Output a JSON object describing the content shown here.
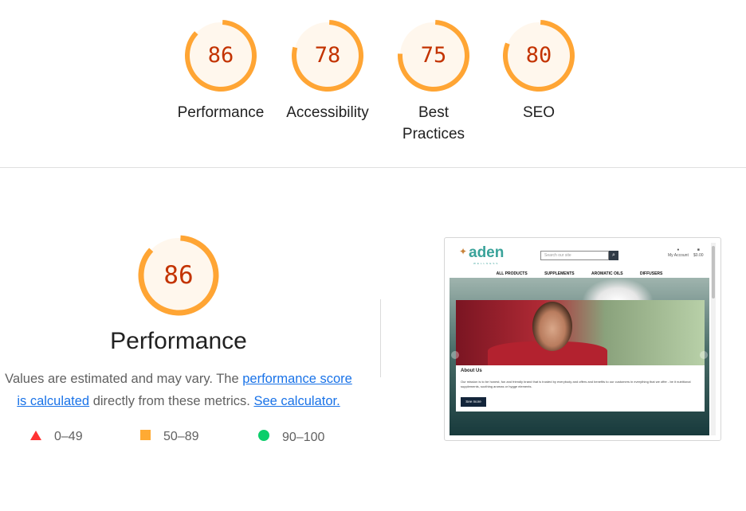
{
  "scores": [
    {
      "label": "Performance",
      "score": 86
    },
    {
      "label": "Accessibility",
      "score": 78
    },
    {
      "label": "Best Practices",
      "score": 75
    },
    {
      "label": "SEO",
      "score": 80
    }
  ],
  "performance": {
    "score": 86,
    "title": "Performance",
    "desc_prefix": "Values are estimated and may vary. The ",
    "link_score": "performance score is calculated",
    "desc_middle": " directly from these metrics. ",
    "link_calc": "See calculator."
  },
  "legend": [
    {
      "range": "0–49",
      "color": "#ff3333",
      "shape": "triangle"
    },
    {
      "range": "50–89",
      "color": "#ffaa33",
      "shape": "square"
    },
    {
      "range": "90–100",
      "color": "#0cce6b",
      "shape": "circle"
    }
  ],
  "colors": {
    "average_stroke": "#ffa534",
    "average_fill": "#fff7ed",
    "average_text": "#c33300"
  },
  "screenshot": {
    "logo": "aden",
    "logo_sub": "WELLNESS",
    "search_placeholder": "Search our site",
    "account": "My Account",
    "cart": "$0.00",
    "nav": [
      "ALL PRODUCTS",
      "SUPPLEMENTS",
      "AROMATIC OILS",
      "DIFFUSERS"
    ],
    "card_title": "About Us",
    "card_text": "Our mission is to be honest, fun and friendly brand that is trusted by everybody and offers and benefits to our customers in everything that we offer - be it nutritional supplements, soothing aromas or hygge elements.",
    "card_button": "See more"
  }
}
